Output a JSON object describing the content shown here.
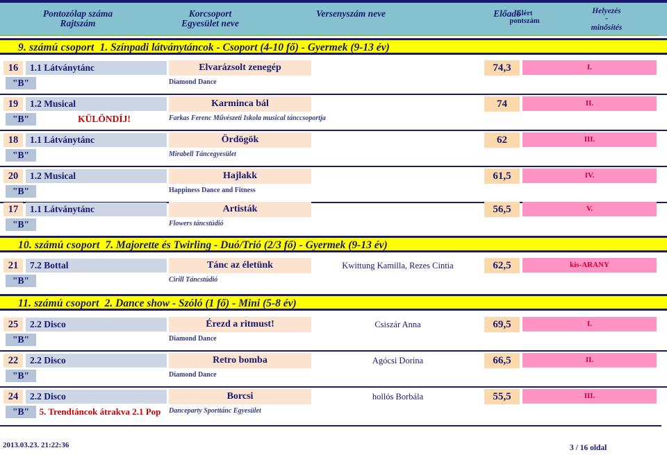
{
  "header": {
    "col_a_line1": "Pontozólap száma",
    "col_a_line2": "Rajtszám",
    "col_b_line1": "Korcsoport",
    "col_b_line2": "Egyesület neve",
    "col_c": "Versenyszám neve",
    "col_d": "Előadó",
    "col_e_line1": "Elért",
    "col_e_line2": "pontszám",
    "col_f_line1": "Helyezés",
    "col_f_dash": "-",
    "col_f_line2": "minősítés"
  },
  "groups": [
    {
      "number": "9. számú csoport",
      "title": "1. Színpadi látványtáncok - Csoport (4-10 fő) - Gyermek (9-13 év)",
      "entries": [
        {
          "start_no": "16",
          "tag": "\"B\"",
          "category": "1.1 Látványtánc",
          "award": "",
          "title": "Elvarázsolt zenegép",
          "club": "Diamond Dance",
          "club_style": "upright",
          "performers": "",
          "score": "74,3",
          "placement": "I."
        },
        {
          "start_no": "19",
          "tag": "\"B\"",
          "category": "1.2 Musical",
          "award": "KÜLÖNDÍJ!",
          "title": "Karminca bál",
          "club": "Farkas Ferenc Művészeti Iskola musical tánccsoportja",
          "club_style": "italic",
          "performers": "",
          "score": "74",
          "placement": "II."
        },
        {
          "start_no": "18",
          "tag": "\"B\"",
          "category": "1.1 Látványtánc",
          "award": "",
          "title": "Ördögök",
          "club": "Mirabell Táncegyesület",
          "club_style": "italic",
          "performers": "",
          "score": "62",
          "placement": "III."
        },
        {
          "start_no": "20",
          "tag": "\"B\"",
          "category": "1.2 Musical",
          "award": "",
          "title": "Hajlakk",
          "club": "Happiness Dance and Fitness",
          "club_style": "upright",
          "performers": "",
          "score": "61,5",
          "placement": "IV."
        },
        {
          "start_no": "17",
          "tag": "\"B\"",
          "category": "1.1 Látványtánc",
          "award": "",
          "title": "Artisták",
          "club": "Flowers táncstúdió",
          "club_style": "italic",
          "performers": "",
          "score": "56,5",
          "placement": "V."
        }
      ]
    },
    {
      "number": "10. számú csoport",
      "title": "7. Majorette és Twirling - Duó/Trió (2/3 fő) - Gyermek (9-13 év)",
      "entries": [
        {
          "start_no": "21",
          "tag": "\"B\"",
          "category": "7.2 Bottal",
          "award": "",
          "title": "Tánc az életünk",
          "club": "Cirill Táncstúdió",
          "club_style": "italic",
          "performers": "Kwittung Kamilla, Rezes Cintia",
          "score": "62,5",
          "placement": "kis-ARANY"
        }
      ]
    },
    {
      "number": "11. számú csoport",
      "title": "2. Dance show - Szóló (1 fő) - Mini (5-8 év)",
      "entries": [
        {
          "start_no": "25",
          "tag": "\"B\"",
          "category": "2.2 Disco",
          "award": "",
          "title": "Érezd a ritmust!",
          "club": "Diamond Dance",
          "club_style": "upright",
          "performers": "Csiszár Anna",
          "score": "69,5",
          "placement": "I."
        },
        {
          "start_no": "22",
          "tag": "\"B\"",
          "category": "2.2 Disco",
          "award": "",
          "title": "Retro bomba",
          "club": "Diamond Dance",
          "club_style": "upright",
          "performers": "Agócsi Dorina",
          "score": "66,5",
          "placement": "II."
        },
        {
          "start_no": "24",
          "tag": "\"B\"",
          "category": "2.2 Disco",
          "award": "5. Trendtáncok átrakva 2.1 Pop",
          "title": "Borcsi",
          "club": "Danceparty Sporttánc Egyesület",
          "club_style": "italic",
          "performers": "hollós Borbála",
          "score": "55,5",
          "placement": "III."
        }
      ]
    }
  ],
  "footer": {
    "timestamp": "2013.03.23. 21:22:36",
    "page": "3 / 16 oldal"
  },
  "colors": {
    "header_band": "#86c1cf",
    "group_band": "#ffff00",
    "rule": "#191970",
    "peach": "#fbe3cf",
    "blue_grey": "#ccd6e4",
    "pink": "#ff94c4",
    "award_red": "#cc0000"
  }
}
